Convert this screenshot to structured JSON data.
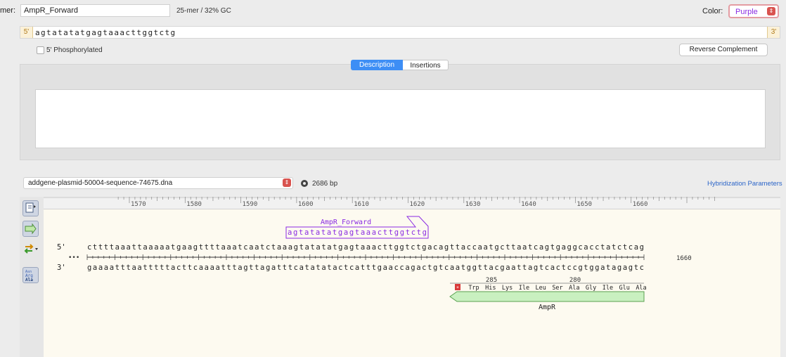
{
  "primer": {
    "label": "mer:",
    "name": "AmpR_Forward",
    "stats": "25-mer  /  32% GC",
    "color_label": "Color:",
    "color_value": "Purple",
    "end5": "5'",
    "end3": "3'",
    "sequence": "agtatatatgagtaaacttggtctg",
    "phosphorylated_label": "5' Phosphorylated",
    "reverse_complement_label": "Reverse Complement"
  },
  "tabs": [
    {
      "label": "Description",
      "active": true
    },
    {
      "label": "Insertions",
      "active": false
    }
  ],
  "template": {
    "file": "addgene-plasmid-50004-sequence-74675.dna",
    "length": "2686 bp",
    "hyb_params": "Hybridization Parameters"
  },
  "sequence_view": {
    "ruler_ticks": [
      "1570",
      "1580",
      "1590",
      "1600",
      "1610",
      "1620",
      "1630",
      "1640",
      "1650",
      "1660"
    ],
    "primer_label": "AmpR_Forward",
    "primer_seq": "agtatatatgagtaaacttggtctg",
    "top_label": "5'",
    "bottom_label": "3'",
    "ellipsis": "•••",
    "top_strand": "cttttaaattaaaaatgaagttttaaatcaatctaaagtatatatgagtaaacttggtctgacagttaccaatgcttaatcagtgaggcacctatctcag",
    "bottom_strand": "gaaaatttaatttttacttcaaaatttagttagatttcatatatactcatttgaaccagactgtcaatggttacgaattagtcactccgtggatagagtc",
    "end_position": "1660",
    "translation_positions": [
      "285",
      "280"
    ],
    "amino_acids": [
      "Trp",
      "His",
      "Lys",
      "Ile",
      "Leu",
      "Ser",
      "Ala",
      "Gly",
      "Ile",
      "Glu",
      "Ala"
    ],
    "feature_name": "AmpR"
  },
  "colors": {
    "primer": "#8a2be2",
    "feature_fill": "#c9f0c0",
    "feature_stroke": "#5aa04f",
    "accent": "#3d8ef5",
    "stepper": "#d9534f"
  },
  "tool_icons": [
    "select-cursor-icon",
    "arrow-feature-icon",
    "swap-strands-icon",
    "amino-acid-icon"
  ]
}
